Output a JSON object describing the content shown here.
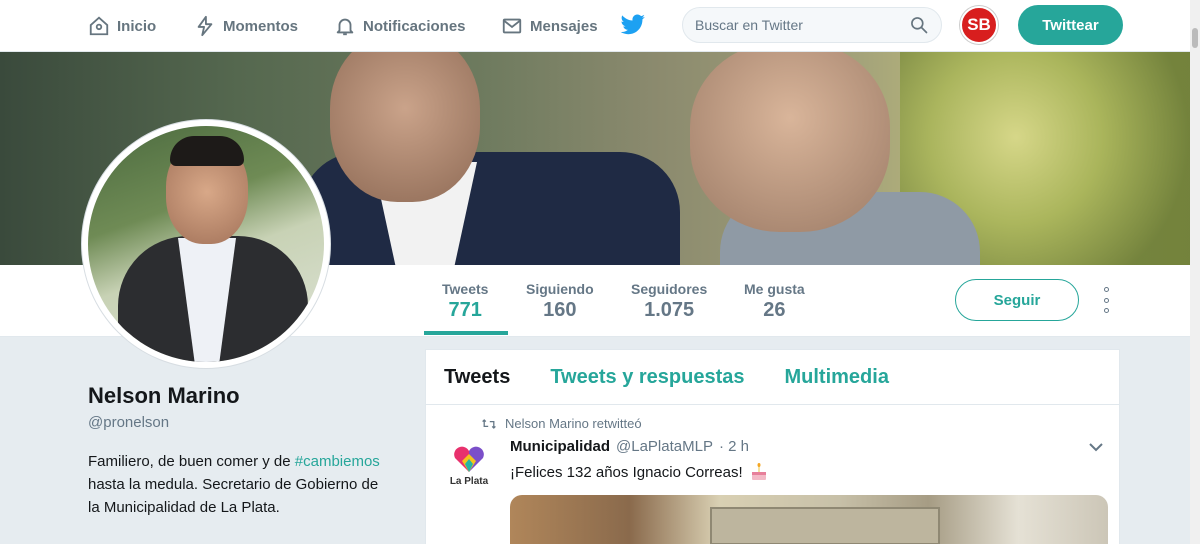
{
  "nav": {
    "items": [
      {
        "label": "Inicio",
        "icon": "home-icon"
      },
      {
        "label": "Momentos",
        "icon": "lightning-icon"
      },
      {
        "label": "Notificaciones",
        "icon": "bell-icon"
      },
      {
        "label": "Mensajes",
        "icon": "envelope-icon"
      }
    ],
    "logo_icon": "twitter-bird-icon",
    "search_placeholder": "Buscar en Twitter",
    "user_avatar_text": "SB",
    "tweet_button": "Twittear"
  },
  "profile": {
    "name": "Nelson Marino",
    "handle": "@pronelson",
    "bio_before": "Familiero, de buen comer y de ",
    "bio_hashtag": "#cambiemos",
    "bio_after": " hasta la medula. Secretario de Gobierno de la Municipalidad de La Plata.",
    "stats": [
      {
        "label": "Tweets",
        "value": "771"
      },
      {
        "label": "Siguiendo",
        "value": "160"
      },
      {
        "label": "Seguidores",
        "value": "1.075"
      },
      {
        "label": "Me gusta",
        "value": "26"
      }
    ],
    "follow_button": "Seguir"
  },
  "timeline": {
    "tabs": [
      "Tweets",
      "Tweets y respuestas",
      "Multimedia"
    ],
    "tweet": {
      "retweet_note": "Nelson Marino retwitteó",
      "author": "Municipalidad",
      "author_handle": "@LaPlataMLP",
      "time": "· 2 h",
      "text": "¡Felices 132 años Ignacio Correas!",
      "logo_text": "La Plata"
    }
  },
  "colors": {
    "accent": "#26a69a",
    "avatar_red": "#d81e1e"
  }
}
